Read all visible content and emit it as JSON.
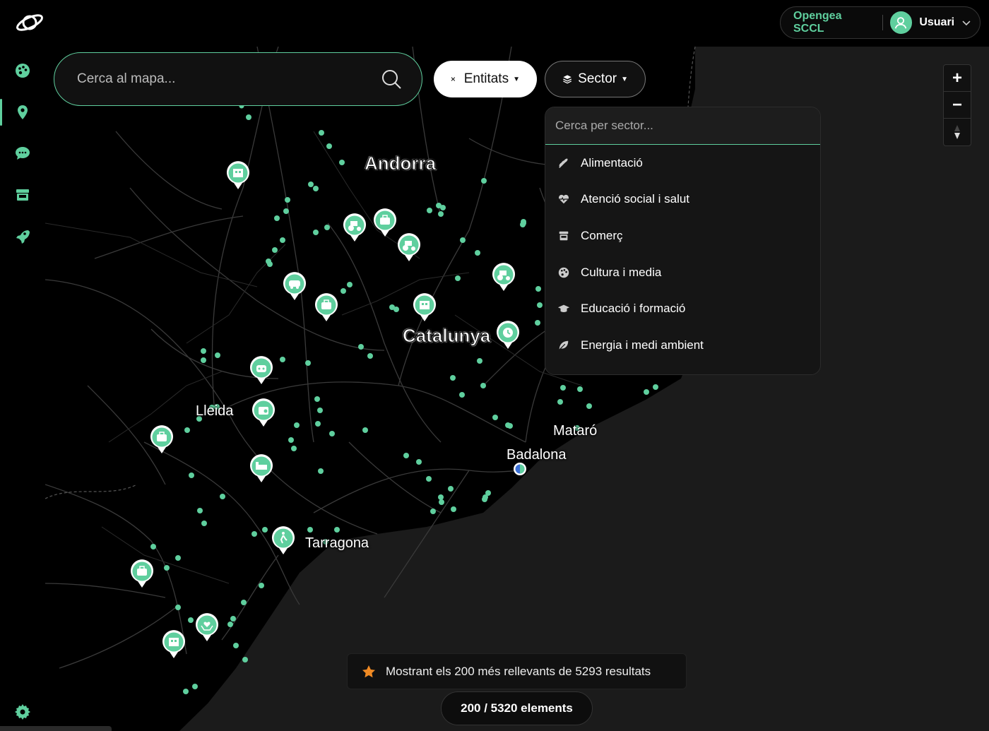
{
  "topbar": {
    "org_name": "Opengea SCCL",
    "user_name": "Usuari"
  },
  "sidebar": {
    "items": [
      {
        "name": "dashboard",
        "icon": "palette-icon"
      },
      {
        "name": "map",
        "icon": "map-pin-icon",
        "active": true
      },
      {
        "name": "messages",
        "icon": "chat-icon"
      },
      {
        "name": "store",
        "icon": "store-icon"
      },
      {
        "name": "launch",
        "icon": "rocket-icon"
      }
    ],
    "settings_icon": "gear-icon"
  },
  "search": {
    "placeholder": "Cerca al mapa..."
  },
  "filters": {
    "entitats_label": "Entitats",
    "sector_label": "Sector"
  },
  "sector_dropdown": {
    "placeholder": "Cerca per sector...",
    "items": [
      {
        "label": "Alimentació",
        "icon": "wheat-icon"
      },
      {
        "label": "Atenció social i salut",
        "icon": "heart-pulse-icon"
      },
      {
        "label": "Comerç",
        "icon": "store-icon"
      },
      {
        "label": "Cultura i media",
        "icon": "palette-icon"
      },
      {
        "label": "Educació i formació",
        "icon": "graduation-cap-icon"
      },
      {
        "label": "Energia i medi ambient",
        "icon": "leaf-icon"
      }
    ]
  },
  "map": {
    "labels": {
      "andorra": "Andorra",
      "catalunya": "Catalunya",
      "lleida": "Lleida",
      "tarragona": "Tarragona",
      "mataro": "Mataró",
      "badalona": "Badalona"
    }
  },
  "notice": {
    "text": "Mostrant els 200 més rellevants de 5293 resultats"
  },
  "count": {
    "text": "200 / 5320 elements"
  },
  "colors": {
    "accent": "#5fcf9e",
    "background": "#000000",
    "land": "#000000",
    "sea": "#1a1a1a",
    "star": "#f08a24"
  }
}
